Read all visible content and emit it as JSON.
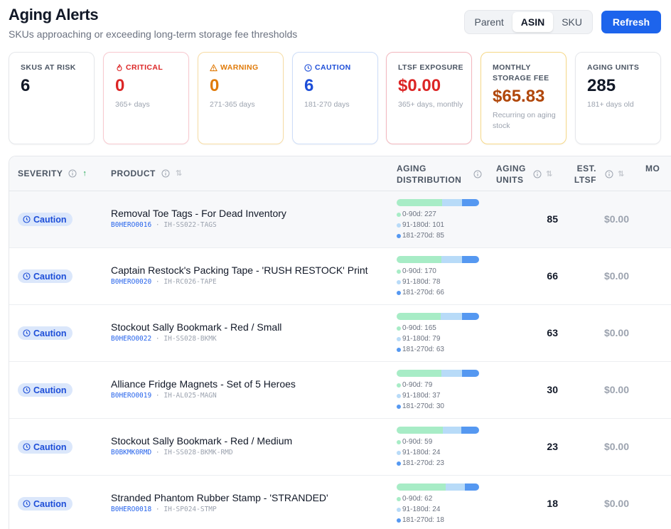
{
  "header": {
    "title": "Aging Alerts",
    "subtitle": "SKUs approaching or exceeding long-term storage fee thresholds"
  },
  "view_toggle": {
    "options": [
      "Parent",
      "ASIN",
      "SKU"
    ],
    "selected": "ASIN"
  },
  "refresh_label": "Refresh",
  "cards": [
    {
      "label": "SKUS AT RISK",
      "value": "6",
      "sub": "",
      "icon": "",
      "color": "#111827"
    },
    {
      "label": "CRITICAL",
      "value": "0",
      "sub": "365+ days",
      "icon": "flame-icon",
      "color": "#dc2626"
    },
    {
      "label": "WARNING",
      "value": "0",
      "sub": "271-365 days",
      "icon": "warning-triangle-icon",
      "color": "#e07b0a"
    },
    {
      "label": "CAUTION",
      "value": "6",
      "sub": "181-270 days",
      "icon": "clock-icon",
      "color": "#1d4ed8"
    },
    {
      "label": "LTSF EXPOSURE",
      "value": "$0.00",
      "sub": "365+ days, monthly",
      "icon": "",
      "color": "#dc2626"
    },
    {
      "label": "MONTHLY STORAGE FEE",
      "value": "$65.83",
      "sub": "Recurring on aging stock",
      "icon": "",
      "color": "#b0470a"
    },
    {
      "label": "AGING UNITS",
      "value": "285",
      "sub": "181+ days old",
      "icon": "",
      "color": "#111827"
    }
  ],
  "table": {
    "columns": [
      {
        "label": "SEVERITY",
        "sort": "asc"
      },
      {
        "label": "PRODUCT",
        "sort": "none"
      },
      {
        "label": "AGING DISTRIBUTION",
        "sort": "none"
      },
      {
        "label": "AGING UNITS",
        "sort": "none"
      },
      {
        "label": "EST. LTSF",
        "sort": "none"
      },
      {
        "label": "MO",
        "sort": "none"
      }
    ],
    "rows": [
      {
        "severity": "Caution",
        "name": "Removal Toe Tags - For Dead Inventory",
        "asin": "B0HERO0016",
        "sku": "IH-SS022-TAGS",
        "d1": 227,
        "d2": 101,
        "d3": 85,
        "d1_label": "0-90d: 227",
        "d2_label": "91-180d: 101",
        "d3_label": "181-270d: 85",
        "units": "85",
        "ltsf": "$0.00"
      },
      {
        "severity": "Caution",
        "name": "Captain Restock's Packing Tape - 'RUSH RESTOCK' Print",
        "asin": "B0HERO0020",
        "sku": "IH-RC026-TAPE",
        "d1": 170,
        "d2": 78,
        "d3": 66,
        "d1_label": "0-90d: 170",
        "d2_label": "91-180d: 78",
        "d3_label": "181-270d: 66",
        "units": "66",
        "ltsf": "$0.00"
      },
      {
        "severity": "Caution",
        "name": "Stockout Sally Bookmark - Red / Small",
        "asin": "B0HERO0022",
        "sku": "IH-SS028-BKMK",
        "d1": 165,
        "d2": 79,
        "d3": 63,
        "d1_label": "0-90d: 165",
        "d2_label": "91-180d: 79",
        "d3_label": "181-270d: 63",
        "units": "63",
        "ltsf": "$0.00"
      },
      {
        "severity": "Caution",
        "name": "Alliance Fridge Magnets - Set of 5 Heroes",
        "asin": "B0HERO0019",
        "sku": "IH-AL025-MAGN",
        "d1": 79,
        "d2": 37,
        "d3": 30,
        "d1_label": "0-90d: 79",
        "d2_label": "91-180d: 37",
        "d3_label": "181-270d: 30",
        "units": "30",
        "ltsf": "$0.00"
      },
      {
        "severity": "Caution",
        "name": "Stockout Sally Bookmark - Red / Medium",
        "asin": "B0BKMK0RMD",
        "sku": "IH-SS028-BKMK-RMD",
        "d1": 59,
        "d2": 24,
        "d3": 23,
        "d1_label": "0-90d: 59",
        "d2_label": "91-180d: 24",
        "d3_label": "181-270d: 23",
        "units": "23",
        "ltsf": "$0.00"
      },
      {
        "severity": "Caution",
        "name": "Stranded Phantom Rubber Stamp - 'STRANDED'",
        "asin": "B0HERO0018",
        "sku": "IH-SP024-STMP",
        "d1": 62,
        "d2": 24,
        "d3": 18,
        "d1_label": "0-90d: 62",
        "d2_label": "91-180d: 24",
        "d3_label": "181-270d: 18",
        "units": "18",
        "ltsf": "$0.00"
      }
    ]
  },
  "colors": {
    "accent": "#1d64ec",
    "dist_0_90": "#a7ecc6",
    "dist_91_180": "#b8dbf8",
    "dist_181_270": "#5598f1"
  }
}
